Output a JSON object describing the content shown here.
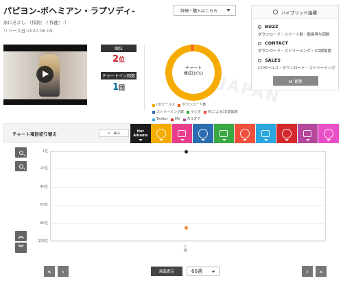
{
  "song": {
    "title": "パピヨン-ボヘミアン・ラプソディ-",
    "credit": "氷川きよし （作詞：-/ 作曲：-）",
    "release": "リリース日:2020.06.09"
  },
  "detail_button": "詳細・購入はこちら",
  "stats": {
    "rank_label": "順位",
    "rank_value": "2",
    "rank_unit": "位",
    "chartin_label": "チャートイン回数",
    "chartin_value": "1",
    "chartin_unit": "回"
  },
  "donut": {
    "center_line1": "チャート",
    "center_line2": "構成比(%)",
    "slices": [
      {
        "name": "CDセールス",
        "value": 98.5,
        "color": "#f6ab00"
      },
      {
        "name": "ダウンロード数",
        "value": 1.5,
        "color": "#f05a28"
      }
    ]
  },
  "legend": [
    {
      "name": "CDセールス",
      "color": "#f6ab00"
    },
    {
      "name": "ダウンロード数",
      "color": "#f05a28"
    },
    {
      "name": "ストリーミング数",
      "color": "#2b6cb0"
    },
    {
      "name": "ラジオ",
      "color": "#3aa843"
    },
    {
      "name": "PCによるCD読取数",
      "color": "#ef4f3c"
    },
    {
      "name": "Twitter",
      "color": "#2ca6de"
    },
    {
      "name": "MV",
      "color": "#d3282c"
    },
    {
      "name": "カラオケ",
      "color": "#b5479c"
    }
  ],
  "hybrid": {
    "title": "ハイブリッド指標",
    "options": [
      {
        "label": "BUZZ",
        "sub": "ダウンロード・ツイート数・動画再生回数",
        "selected": true
      },
      {
        "label": "CONTACT",
        "sub": "ダウンロード・ストリーミング・CD読取数",
        "selected": false
      },
      {
        "label": "SALES",
        "sub": "CDセールス・ダウンロード・ストリーミング",
        "selected": false
      }
    ],
    "refresh": "更新"
  },
  "toolbar": {
    "title": "チャート項目切り替え",
    "all": "ALL",
    "all_check": "✓",
    "hot_line1": "Hot",
    "hot_line2": "Albums",
    "categories": [
      {
        "name": "cd-sales",
        "color": "#f6ab00"
      },
      {
        "name": "download",
        "color": "#e83e8c"
      },
      {
        "name": "streaming",
        "color": "#2b6cb0"
      },
      {
        "name": "radio",
        "color": "#3aa843"
      },
      {
        "name": "pc-cd-read",
        "color": "#ef4f3c"
      },
      {
        "name": "twitter",
        "color": "#2ca6de"
      },
      {
        "name": "youtube",
        "color": "#d3282c"
      },
      {
        "name": "karaoke",
        "color": "#b5479c"
      },
      {
        "name": "extra",
        "color": "#e94fc7"
      }
    ]
  },
  "chart_data": {
    "type": "scatter",
    "y_ticks": [
      "1位",
      "20位",
      "40位",
      "60位",
      "80位",
      "100位"
    ],
    "ylim": [
      1,
      100
    ],
    "y_reversed": true,
    "x_ticks": [
      "1",
      "週"
    ],
    "series": [
      {
        "color": "#222222",
        "values": [
          {
            "x": 1,
            "y": 1
          }
        ]
      },
      {
        "color": "#f08a28",
        "values": [
          {
            "x": 1,
            "y": 85
          }
        ]
      }
    ]
  },
  "bottom": {
    "first": "«",
    "prev": "‹",
    "next": "›",
    "last": "»",
    "display_label": "画面表示",
    "display_value": "60週"
  }
}
